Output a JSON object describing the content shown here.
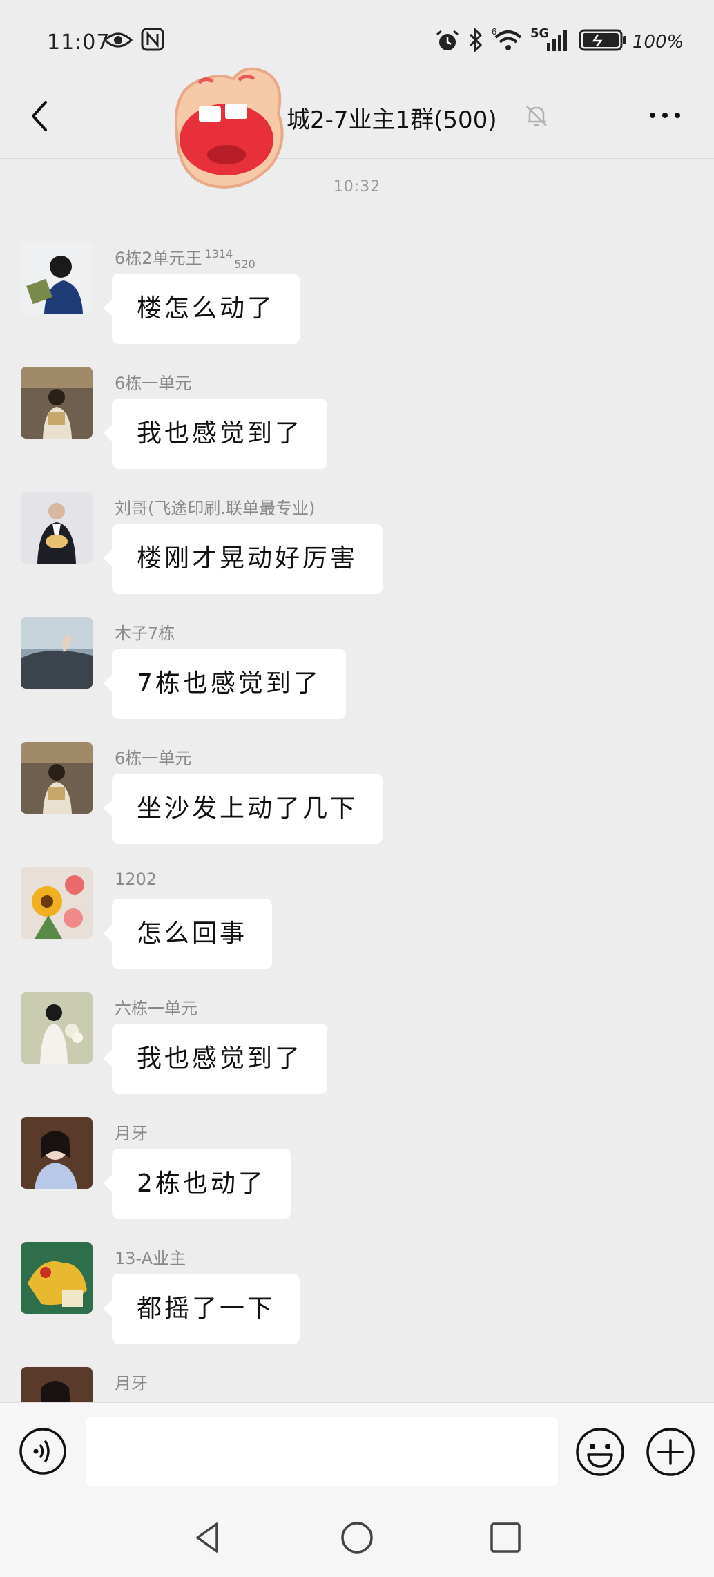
{
  "status_bar": {
    "time": "11:07",
    "network": "5G",
    "wifi_level": "6",
    "battery": "100%",
    "icons": [
      "eye-icon",
      "nfc-icon",
      "alarm-icon",
      "bluetooth-icon",
      "wifi-icon",
      "signal-icon",
      "battery-icon"
    ]
  },
  "header": {
    "back_icon": "chevron-left-icon",
    "title": "城2-7业主1群(500)",
    "mute_icon": "bell-off-icon",
    "more_icon": "more-dots-icon"
  },
  "chat": {
    "timestamp": "10:32",
    "messages": [
      {
        "sender": "6栋2单元王",
        "sender_sup": "1314",
        "sender_sub": "520",
        "text": "楼怎么动了"
      },
      {
        "sender": "6栋一单元",
        "text": "我也感觉到了"
      },
      {
        "sender": "刘哥(飞途印刷.联单最专业)",
        "text": "楼刚才晃动好厉害"
      },
      {
        "sender": "木子7栋",
        "text": "7栋也感觉到了"
      },
      {
        "sender": "6栋一单元",
        "text": "坐沙发上动了几下"
      },
      {
        "sender": "1202",
        "text": "怎么回事"
      },
      {
        "sender": "六栋一单元",
        "text": "我也感觉到了"
      },
      {
        "sender": "月牙",
        "text": "2栋也动了"
      },
      {
        "sender": "13-A业主",
        "text": "都摇了一下"
      },
      {
        "sender": "月牙",
        "text": ""
      }
    ]
  },
  "input_bar": {
    "voice_icon": "voice-icon",
    "text_value": "",
    "emoji_icon": "emoji-icon",
    "plus_icon": "plus-icon"
  },
  "system_nav": {
    "icons": [
      "back-triangle-icon",
      "home-circle-icon",
      "recents-square-icon"
    ]
  },
  "colors": {
    "background": "#ededed",
    "bubble": "#ffffff",
    "sender_text": "#8a8a8a",
    "sticker": "#e8303a"
  }
}
